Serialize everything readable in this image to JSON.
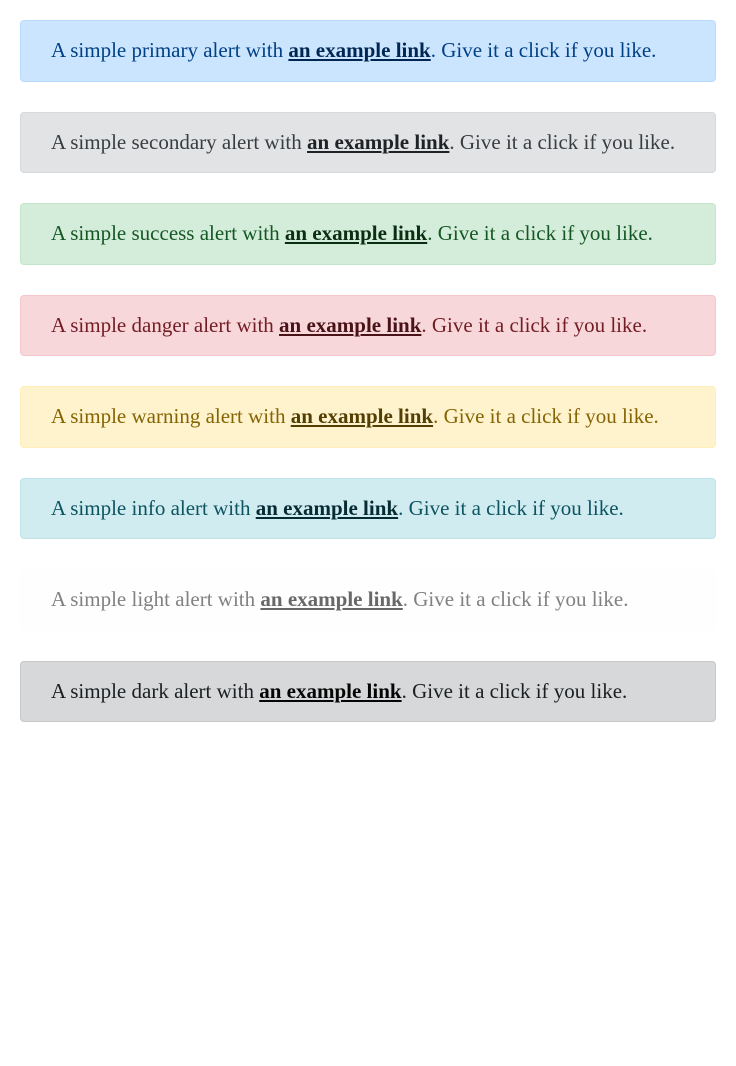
{
  "alerts": [
    {
      "type": "primary",
      "prefix": "A simple primary alert with ",
      "link": "an example link",
      "suffix": ". Give it a click if you like."
    },
    {
      "type": "secondary",
      "prefix": "A simple secondary alert with ",
      "link": "an example link",
      "suffix": ". Give it a click if you like."
    },
    {
      "type": "success",
      "prefix": "A simple success alert with ",
      "link": "an example link",
      "suffix": ". Give it a click if you like."
    },
    {
      "type": "danger",
      "prefix": "A simple danger alert with ",
      "link": "an example link",
      "suffix": ". Give it a click if you like."
    },
    {
      "type": "warning",
      "prefix": "A simple warning alert with ",
      "link": "an example link",
      "suffix": ". Give it a click if you like."
    },
    {
      "type": "info",
      "prefix": "A simple info alert with ",
      "link": "an example link",
      "suffix": ". Give it a click if you like."
    },
    {
      "type": "light",
      "prefix": "A simple light alert with ",
      "link": "an example link",
      "suffix": ". Give it a click if you like."
    },
    {
      "type": "dark",
      "prefix": "A simple dark alert with ",
      "link": "an example link",
      "suffix": ". Give it a click if you like."
    }
  ]
}
